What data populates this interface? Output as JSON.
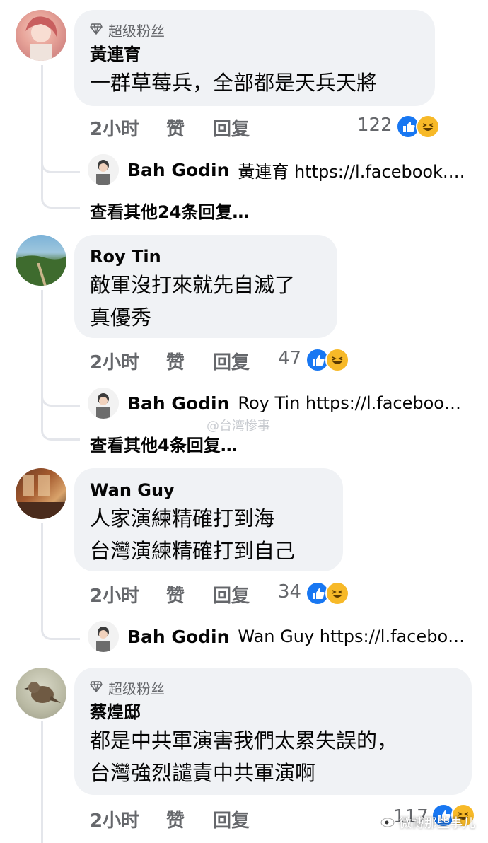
{
  "comments": [
    {
      "badge": "超级粉丝",
      "name": "黃連育",
      "lines": [
        "一群草莓兵，全部都是天兵天將"
      ],
      "time": "2小时",
      "like": "赞",
      "reply": "回复",
      "reactions": "122",
      "reply_preview": {
        "name": "Bah Godin",
        "text": "黃連育 https://l.facebook.…"
      },
      "more": "查看其他24条回复…"
    },
    {
      "name": "Roy Tin",
      "lines": [
        "敵軍沒打來就先自滅了",
        "真優秀"
      ],
      "time": "2小时",
      "like": "赞",
      "reply": "回复",
      "reactions": "47",
      "reply_preview": {
        "name": "Bah Godin",
        "text": "Roy Tin https://l.faceboo…"
      },
      "more": "查看其他4条回复…"
    },
    {
      "name": "Wan Guy",
      "lines": [
        "人家演練精確打到海",
        "台灣演練精確打到自己"
      ],
      "time": "2小时",
      "like": "赞",
      "reply": "回复",
      "reactions": "34",
      "reply_preview": {
        "name": "Bah Godin",
        "text": "Wan Guy https://l.facebo…"
      }
    },
    {
      "badge": "超级粉丝",
      "name": "蔡煌邸",
      "lines": [
        "都是中共軍演害我們太累失誤的，",
        "台灣強烈譴責中共軍演啊"
      ],
      "time": "2小时",
      "like": "赞",
      "reply": "回复",
      "reactions": "117"
    }
  ],
  "watermarks": {
    "center": "@台湾惨事",
    "corner": "微博那些事儿"
  },
  "colors": {
    "bubble": "#f0f2f5",
    "secondary_text": "#65676b",
    "like_blue": "#1877f2",
    "haha_yellow": "#f7b928"
  }
}
